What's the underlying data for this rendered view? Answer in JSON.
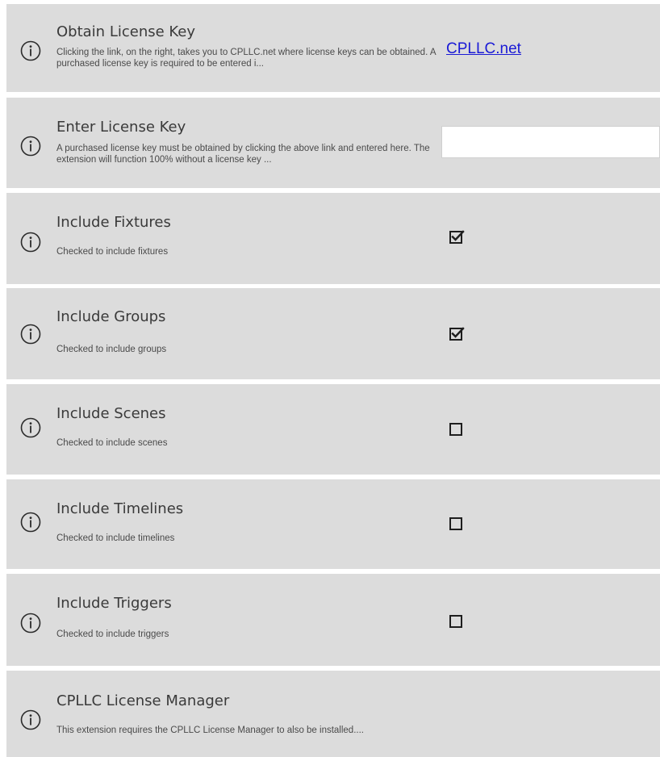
{
  "settings": {
    "license_key": {
      "title": "Obtain License Key",
      "description": "Clicking the link, on the right, takes you to CPLLC.net where license keys can be obtained.  A purchased license key is required to be entered i...",
      "link_label": "CPLLC.net"
    },
    "enter_key": {
      "title": "Enter License Key",
      "description": "A purchased license key must be obtained by clicking the above link and entered here. The extension will function 100% without a license key ...",
      "value": "",
      "placeholder": ""
    },
    "fixtures": {
      "title": "Include Fixtures",
      "description": "Checked to include fixtures",
      "checked": true
    },
    "groups": {
      "title": "Include Groups",
      "description": "Checked to include groups",
      "checked": true
    },
    "scenes": {
      "title": "Include Scenes",
      "description": "Checked to include scenes",
      "checked": false
    },
    "timelines": {
      "title": "Include Timelines",
      "description": "Checked to include timelines",
      "checked": false
    },
    "triggers": {
      "title": "Include Triggers",
      "description": "Checked to include triggers",
      "checked": false
    },
    "license_manager": {
      "title": "CPLLC License Manager",
      "description": "This extension requires the CPLLC License Manager to also be installed...."
    }
  },
  "icons": {
    "info": "info-circle-icon",
    "checked": "checkbox-checked-icon",
    "unchecked": "checkbox-unchecked-icon"
  },
  "colors": {
    "row_background": "#dcdcdc",
    "link": "#1a1ad6",
    "text": "#3a3a3a"
  }
}
